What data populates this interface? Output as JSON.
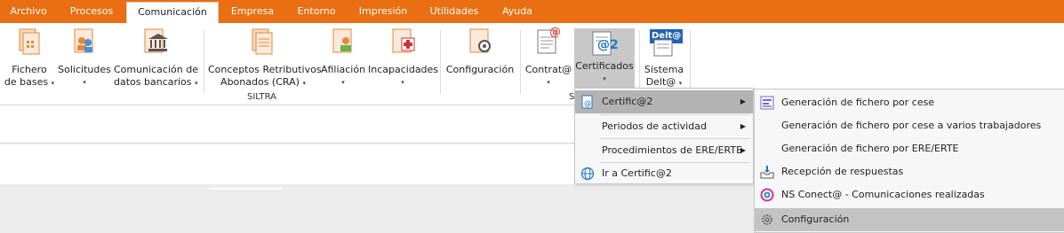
{
  "menubar": {
    "tabs": [
      "Archivo",
      "Procesos",
      "Comunicación",
      "Empresa",
      "Entorno",
      "Impresión",
      "Utilidades",
      "Ayuda"
    ],
    "active": "Comunicación"
  },
  "ribbon": {
    "buttons": [
      {
        "line1": "Fichero",
        "line2": "de bases",
        "dropdown": "inline"
      },
      {
        "line1": "Solicitudes",
        "line2": "",
        "dropdown": "below"
      },
      {
        "line1": "Comunicación de",
        "line2": "datos bancarios",
        "dropdown": "inline"
      },
      {
        "line1": "Conceptos Retributivos",
        "line2": "Abonados (CRA)",
        "dropdown": "inline"
      },
      {
        "line1": "Afiliación",
        "line2": "",
        "dropdown": "below"
      },
      {
        "line1": "Incapacidades",
        "line2": "",
        "dropdown": "below"
      },
      {
        "line1": "Configuración",
        "line2": "",
        "dropdown": "none"
      },
      {
        "line1": "Contrat@",
        "line2": "",
        "dropdown": "below"
      },
      {
        "line1": "Certificados",
        "line2": "",
        "dropdown": "below"
      },
      {
        "line1": "Sistema",
        "line2": "Delt@",
        "dropdown": "inline"
      }
    ],
    "group_label_siltra": "SILTRA",
    "group_label_cut": "S",
    "badge_certificados": "@2",
    "badge_contrata": "@",
    "badge_delta": "Delt@",
    "dropdown_arrow": "▾"
  },
  "dropdown": {
    "items": [
      {
        "label": "Certific@2",
        "submenu": true,
        "highlighted": true
      },
      {
        "label": "Periodos de actividad",
        "submenu": true,
        "highlighted": false
      },
      {
        "label": "Procedimientos de ERE/ERTE",
        "submenu": true,
        "highlighted": false
      },
      {
        "label": "Ir a Certific@2",
        "submenu": false,
        "highlighted": false
      }
    ],
    "submenu_arrow": "▶"
  },
  "submenu": {
    "items": [
      {
        "label": "Generación de fichero por cese",
        "icon": "file-generate-icon"
      },
      {
        "label": "Generación de fichero por cese a varios trabajadores",
        "icon": ""
      },
      {
        "label": "Generación de fichero por ERE/ERTE",
        "icon": ""
      },
      {
        "label": "Recepción de respuestas",
        "icon": "inbox-download-icon"
      },
      {
        "label": "NS Conect@ - Comunicaciones realizadas",
        "icon": "at-sign-icon"
      },
      {
        "label": "Configuración",
        "icon": "gear-icon"
      }
    ]
  },
  "colors": {
    "menubar": "#e96f12",
    "highlight": "#b3b3b3",
    "icon_orange": "#e8873a",
    "icon_blue": "#1f77c4"
  }
}
